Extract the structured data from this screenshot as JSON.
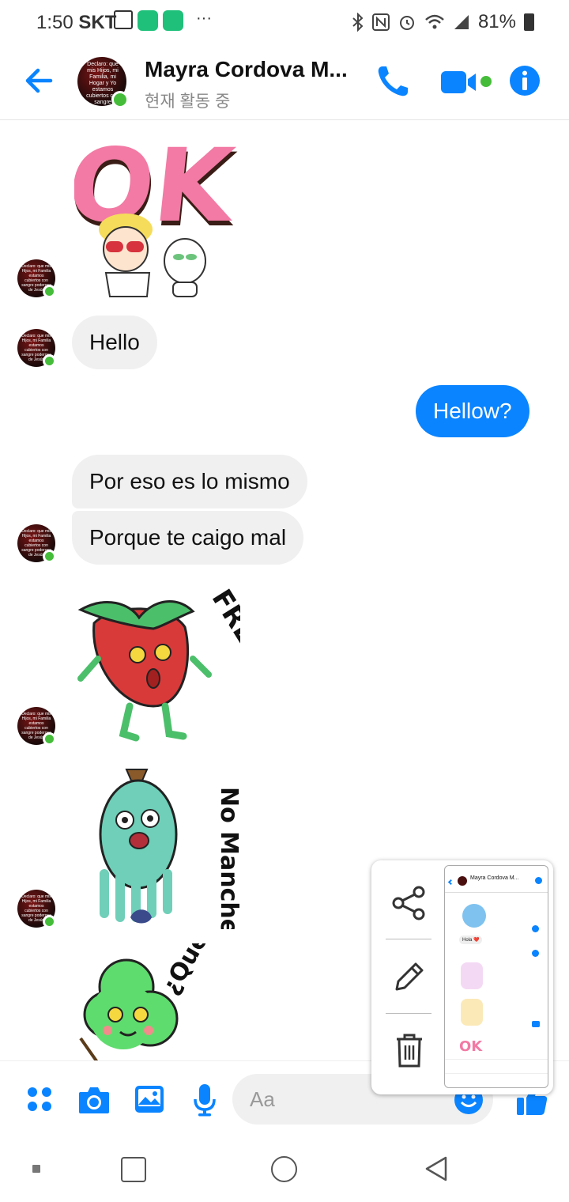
{
  "status_bar": {
    "time": "1:50",
    "carrier": "SKT",
    "more": "···",
    "battery": "81%"
  },
  "header": {
    "contact_name": "Mayra Cordova M...",
    "activity_status": "현재 활동 중",
    "accent_color": "#0a84ff",
    "online_color": "#45bd3a"
  },
  "messages": {
    "hello": "Hello",
    "hellow": "Hellow?",
    "por_eso": "Por eso es lo mismo",
    "porque": "Porque te caigo mal"
  },
  "stickers": {
    "ok": "OK",
    "fresa": "FRESA",
    "no_manches": "No Manches",
    "que_pedo": "¿Qué Pedo?"
  },
  "composer": {
    "placeholder": "Aa"
  },
  "overlay": {
    "thumb_name": "Mayra Cordova M...",
    "thumb_msg": "Hola ❤️",
    "thumb_ok": "OK"
  }
}
